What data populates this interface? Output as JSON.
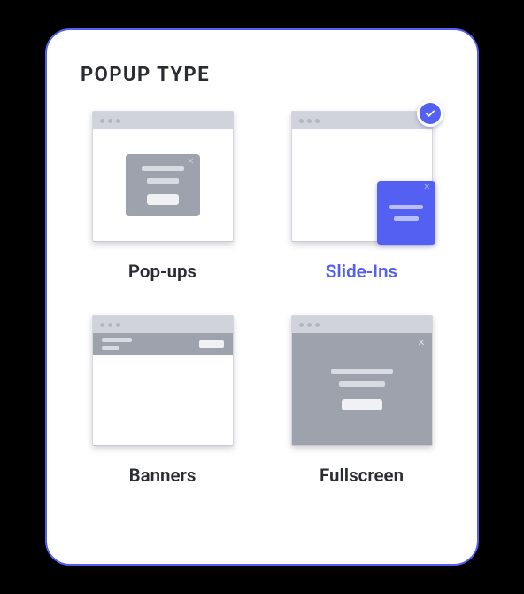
{
  "title": "POPUP TYPE",
  "options": [
    {
      "label": "Pop-ups",
      "selected": false
    },
    {
      "label": "Slide-Ins",
      "selected": true
    },
    {
      "label": "Banners",
      "selected": false
    },
    {
      "label": "Fullscreen",
      "selected": false
    }
  ]
}
